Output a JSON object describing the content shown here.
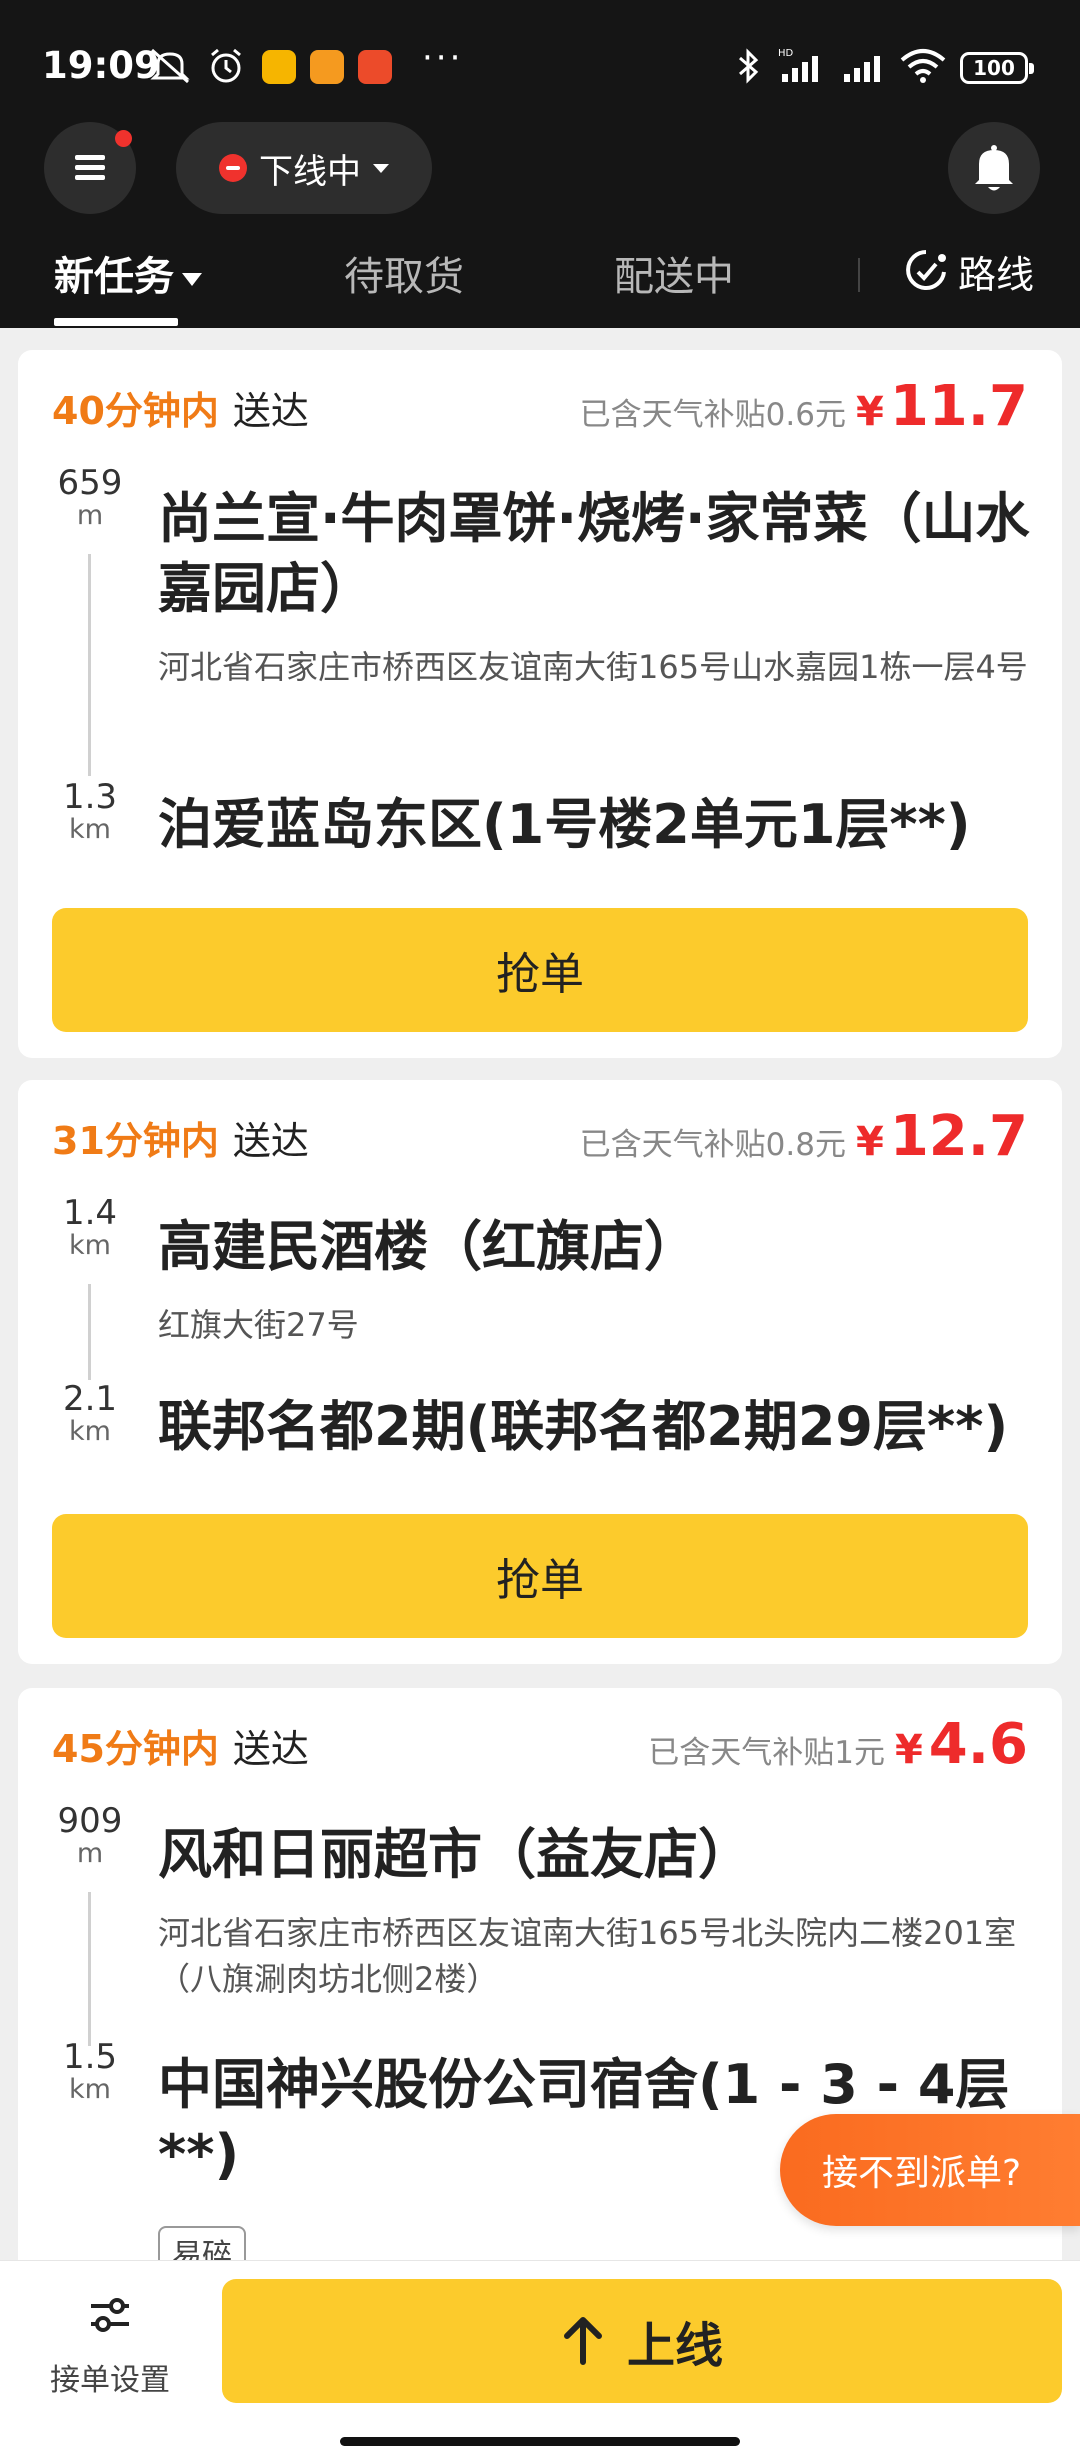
{
  "status_bar": {
    "time": "19:09",
    "battery": "100",
    "more": "···"
  },
  "header": {
    "online_status": "下线中",
    "tabs": [
      {
        "label": "新任务",
        "active": true
      },
      {
        "label": "待取货",
        "active": false
      },
      {
        "label": "配送中",
        "active": false
      }
    ],
    "route_label": "路线"
  },
  "orders": [
    {
      "deadline": "40分钟内",
      "deadline_verb": "送达",
      "subsidy": "已含天气补贴0.6元",
      "currency": "¥",
      "fee": "11.7",
      "pickup_distance": "659",
      "pickup_unit": "m",
      "shop_name": "尚兰宣·牛肉罩饼·烧烤·家常菜（山水嘉园店）",
      "shop_address": "河北省石家庄市桥西区友谊南大街165号山水嘉园1栋一层4号",
      "delivery_distance": "1.3",
      "delivery_unit": "km",
      "destination": "泊爱蓝岛东区(1号楼2单元1层**)",
      "button": "抢单"
    },
    {
      "deadline": "31分钟内",
      "deadline_verb": "送达",
      "subsidy": "已含天气补贴0.8元",
      "currency": "¥",
      "fee": "12.7",
      "pickup_distance": "1.4",
      "pickup_unit": "km",
      "shop_name": "高建民酒楼（红旗店）",
      "shop_address": "红旗大街27号",
      "delivery_distance": "2.1",
      "delivery_unit": "km",
      "destination": "联邦名都2期(联邦名都2期29层**)",
      "button": "抢单"
    },
    {
      "deadline": "45分钟内",
      "deadline_verb": "送达",
      "subsidy": "已含天气补贴1元",
      "currency": "¥",
      "fee": "4.6",
      "pickup_distance": "909",
      "pickup_unit": "m",
      "shop_name": "风和日丽超市（益友店）",
      "shop_address": "河北省石家庄市桥西区友谊南大街165号北头院内二楼201室（八旗涮肉坊北侧2楼）",
      "delivery_distance": "1.5",
      "delivery_unit": "km",
      "destination": "中国神兴股份公司宿舍(1 - 3 - 4层**)",
      "tag": "易碎"
    }
  ],
  "floating": {
    "label": "接不到派单?"
  },
  "bottom": {
    "settings_label": "接单设置",
    "online_button": "上线"
  },
  "colors": {
    "header_bg": "#151515",
    "accent_yellow": "#fccb2c",
    "deadline_orange": "#f07b16",
    "fee_red": "#ee2b2b",
    "float_orange": "#fa6b1f"
  }
}
